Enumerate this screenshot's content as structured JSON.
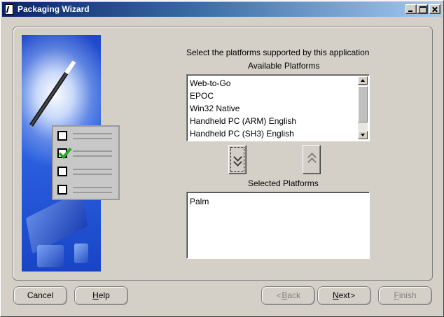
{
  "window": {
    "title": "Packaging Wizard"
  },
  "main": {
    "instruction": "Select the platforms supported by this application",
    "available_label": "Available Platforms",
    "available_platforms": [
      "Web-to-Go",
      "EPOC",
      "Win32 Native",
      "Handheld PC (ARM) English",
      "Handheld PC (SH3) English"
    ],
    "selected_label": "Selected Platforms",
    "selected_platforms": [
      "Palm"
    ]
  },
  "buttons": {
    "cancel": "Cancel",
    "help_mnemonic": "H",
    "help_rest": "elp",
    "back_mnemonic": "B",
    "back_rest": "ack",
    "back_glyph": "<",
    "next_mnemonic": "N",
    "next_rest": "ext",
    "next_glyph": ">",
    "finish_mnemonic": "F",
    "finish_rest": "inish"
  },
  "colors": {
    "titlebar_start": "#0a246a",
    "titlebar_end": "#a6caf0",
    "face": "#d4d0c8",
    "illustration_blue": "#2b60e0"
  },
  "icons": {
    "window": "packaging-wizard-icon",
    "move_down": "double-chevron-down-icon",
    "move_up": "double-chevron-up-icon"
  }
}
